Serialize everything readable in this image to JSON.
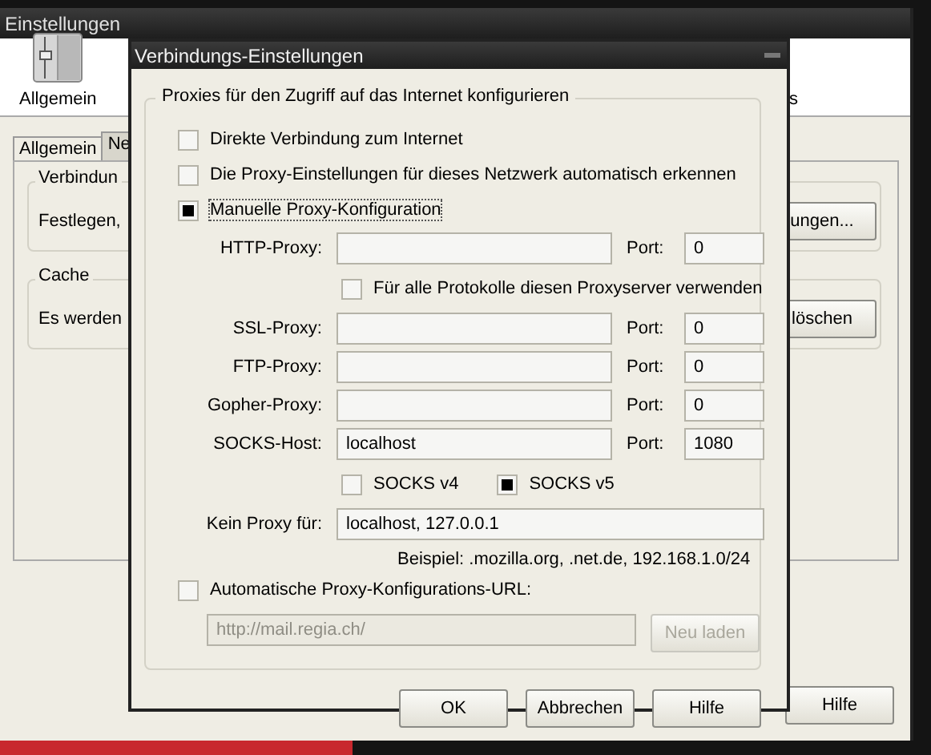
{
  "window": {
    "title": "Einstellungen"
  },
  "toolbar": [
    {
      "label": "Allgemein",
      "kind": "icon"
    },
    {
      "label": "s",
      "kind": "text"
    }
  ],
  "tabs": [
    {
      "label": "Allgemein",
      "selected": false
    },
    {
      "label": "Ne",
      "selected": true
    }
  ],
  "groups": [
    {
      "title": "Verbindun",
      "text": "Festlegen,",
      "button": "ungen..."
    },
    {
      "title": "Cache",
      "text": "Es werden",
      "button": "löschen"
    }
  ],
  "buttons": [
    "Hilfe"
  ],
  "dialog": {
    "title": "Verbindungs-Einstellungen",
    "legend": "Proxies für den Zugriff auf das Internet konfigurieren",
    "options": [
      {
        "label": "Direkte Verbindung zum Internet",
        "checked": false
      },
      {
        "label": "Die Proxy-Einstellungen für dieses Netzwerk automatisch erkennen",
        "checked": false
      },
      {
        "label": "Manuelle Proxy-Konfiguration",
        "checked": true
      }
    ],
    "proxies": [
      {
        "label": "HTTP-Proxy:",
        "port_label": "Port:",
        "port": "0"
      },
      {
        "label": "SSL-Proxy:",
        "port_label": "Port:",
        "port": "0"
      },
      {
        "label": "FTP-Proxy:",
        "port_label": "Port:",
        "port": "0"
      },
      {
        "label": "Gopher-Proxy:",
        "port_label": "Port:",
        "port": "0"
      },
      {
        "label": "SOCKS-Host:",
        "value": "localhost",
        "port_label": "Port:",
        "port": "1080"
      }
    ],
    "share_all": {
      "label": "Für alle Protokolle diesen Proxyserver verwenden",
      "checked": false
    },
    "socks_versions": [
      {
        "label": "SOCKS v4",
        "checked": false
      },
      {
        "label": "SOCKS v5",
        "checked": true
      }
    ],
    "no_proxy": {
      "label": "Kein Proxy für:",
      "value": "localhost, 127.0.0.1"
    },
    "example": "Beispiel: .mozilla.org, .net.de, 192.168.1.0/24",
    "auto_config": {
      "label": "Automatische Proxy-Konfigurations-URL:",
      "checked": false,
      "disabled": true,
      "value": "http://mail.regia.ch/",
      "reload_button": "Neu laden"
    },
    "buttons": [
      "OK",
      "Abbrechen",
      "Hilfe"
    ]
  }
}
